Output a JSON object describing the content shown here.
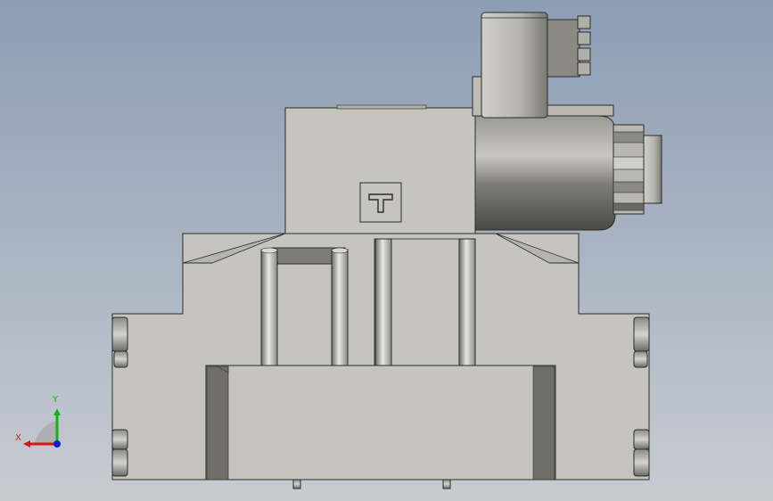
{
  "viewport": {
    "background_top": "#8d9db5",
    "background_bottom": "#c7ccd2"
  },
  "model": {
    "part_color": "#c5c5bd",
    "edge_color": "#2b2b2b",
    "dark_face_color": "#6f6f68",
    "shadow_color": "#3c3c38",
    "symbol_icon": "t-port-symbol-icon"
  },
  "triad": {
    "x_label": "X",
    "y_label": "Y",
    "x_color": "#d01818",
    "y_color": "#18b018",
    "z_color": "#1818d0"
  }
}
